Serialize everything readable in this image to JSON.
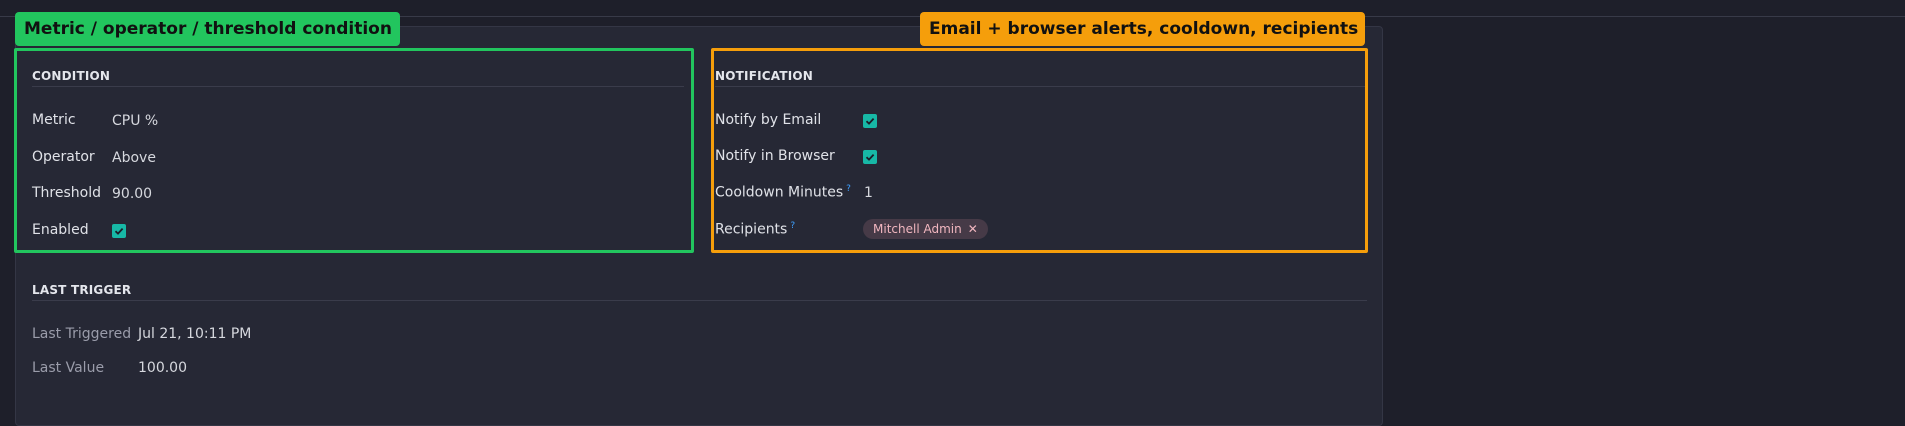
{
  "annotations": {
    "condition_callout": "Metric / operator / threshold condition",
    "notification_callout": "Email + browser alerts, cooldown, recipients"
  },
  "condition": {
    "title": "CONDITION",
    "metric": {
      "label": "Metric",
      "value": "CPU %"
    },
    "operator": {
      "label": "Operator",
      "value": "Above"
    },
    "threshold": {
      "label": "Threshold",
      "value": "90.00"
    },
    "enabled": {
      "label": "Enabled",
      "checked": true
    }
  },
  "notification": {
    "title": "NOTIFICATION",
    "notify_email": {
      "label": "Notify by Email",
      "checked": true
    },
    "notify_browser": {
      "label": "Notify in Browser",
      "checked": true
    },
    "cooldown": {
      "label": "Cooldown Minutes",
      "help": "?",
      "value": "1"
    },
    "recipients": {
      "label": "Recipients",
      "help": "?",
      "tags": [
        "Mitchell Admin"
      ],
      "remove_glyph": "✕"
    }
  },
  "last_trigger": {
    "title": "LAST TRIGGER",
    "last_triggered": {
      "label": "Last Triggered",
      "value": "Jul 21, 10:11 PM"
    },
    "last_value": {
      "label": "Last Value",
      "value": "100.00"
    }
  },
  "colors": {
    "accent_green": "#22c55e",
    "accent_orange": "#f59e0b",
    "checkbox": "#17b8a6",
    "help": "#3ea0ff"
  }
}
